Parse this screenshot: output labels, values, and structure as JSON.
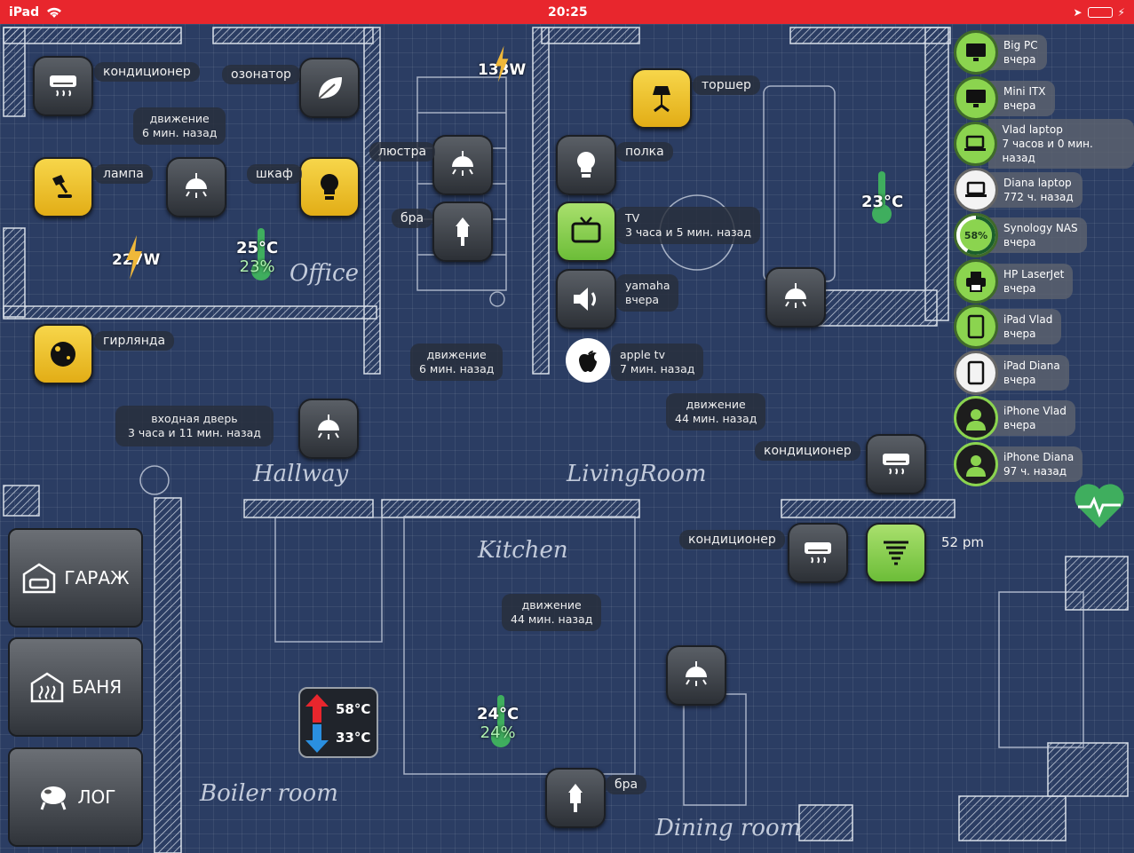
{
  "status_bar": {
    "device": "iPad",
    "time": "20:25"
  },
  "rooms": {
    "office": "Office",
    "hallway": "Hallway",
    "living": "LivingRoom",
    "kitchen": "Kitchen",
    "boiler": "Boiler room",
    "dining": "Dining room"
  },
  "tiles": {
    "conditioner_office": "кондиционер",
    "ozonator": "озонатор",
    "lamp": "лампа",
    "wardrobe": "шкаф",
    "chandelier": "люстра",
    "sconce_1": "бра",
    "garland": "гирлянда",
    "floor_lamp": "торшер",
    "shelf": "полка",
    "tv_title": "TV",
    "tv_sub": "3 часа и 5 мин. назад",
    "yamaha_title": "yamaha",
    "yamaha_sub": "вчера",
    "appletv_title": "apple tv",
    "appletv_sub": "7 мин. назад",
    "conditioner_living": "кондиционер",
    "conditioner_dining": "кондиционер",
    "fan_time": "52 pm",
    "sconce_2": "бра"
  },
  "motion": {
    "office": [
      "движение",
      "6 мин. назад"
    ],
    "hall": [
      "движение",
      "6 мин. назад"
    ],
    "living": [
      "движение",
      "44 мин. назад"
    ],
    "kitchen": [
      "движение",
      "44 мин. назад"
    ],
    "door": [
      "входная дверь",
      "3 часа и 11 мин. назад"
    ]
  },
  "power": {
    "office": "227W",
    "stairs": "133W"
  },
  "climate": {
    "office_temp": "25°C",
    "office_hum": "23%",
    "living_temp": "23°C",
    "kitchen_temp": "24°C",
    "kitchen_hum": "24%",
    "boiler_hot": "58°C",
    "boiler_cold": "33°C"
  },
  "devices": [
    {
      "name": "Big PC",
      "status": "вчера",
      "icon": "monitor-icon"
    },
    {
      "name": "Mini ITX",
      "status": "вчера",
      "icon": "monitor-icon"
    },
    {
      "name": "Vlad laptop",
      "status": "7 часов и 0 мин. назад",
      "icon": "laptop-icon"
    },
    {
      "name": "Diana laptop",
      "status": "772 ч. назад",
      "icon": "laptop-icon"
    },
    {
      "name": "Synology NAS",
      "status": "вчера",
      "icon": "nas-icon",
      "gauge": "58%",
      "gauge_value": 58
    },
    {
      "name": "HP LaserJet",
      "status": "вчера",
      "icon": "printer-icon"
    },
    {
      "name": "iPad Vlad",
      "status": "вчера",
      "icon": "tablet-icon"
    },
    {
      "name": "iPad Diana",
      "status": "вчера",
      "icon": "tablet-icon"
    },
    {
      "name": "iPhone Vlad",
      "status": "вчера",
      "icon": "person-icon"
    },
    {
      "name": "iPhone Diana",
      "status": "97 ч. назад",
      "icon": "person-icon"
    }
  ],
  "side_buttons": {
    "garage": "ГАРАЖ",
    "bath": "БАНЯ",
    "log": "ЛОГ"
  },
  "colors": {
    "status_bar": "#e8262d",
    "background": "#2b3d63",
    "active_yellow": "#f2c52f",
    "active_green": "#8bd44f",
    "humidity_green": "#3fae5e"
  }
}
